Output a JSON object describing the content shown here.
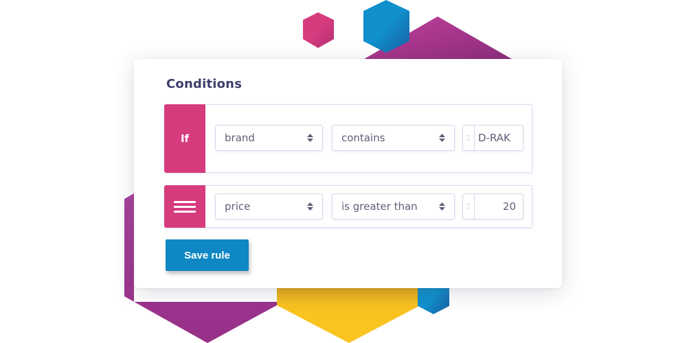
{
  "panel": {
    "title": "Conditions",
    "conditions": [
      {
        "tag": "If",
        "field": "brand",
        "operator": "contains",
        "value": "D-RAK"
      },
      {
        "tag_icon": "hamburger-menu-icon",
        "field": "price",
        "operator": "is greater than",
        "value": "20"
      }
    ],
    "save_label": "Save rule"
  },
  "colors": {
    "accent_pink": "#d63b7e",
    "button_blue": "#0e87c4",
    "title_text": "#3d3d6b",
    "decor_purple": "#a0358f",
    "decor_yellow": "#f8c21f",
    "decor_blue": "#1090cc"
  }
}
